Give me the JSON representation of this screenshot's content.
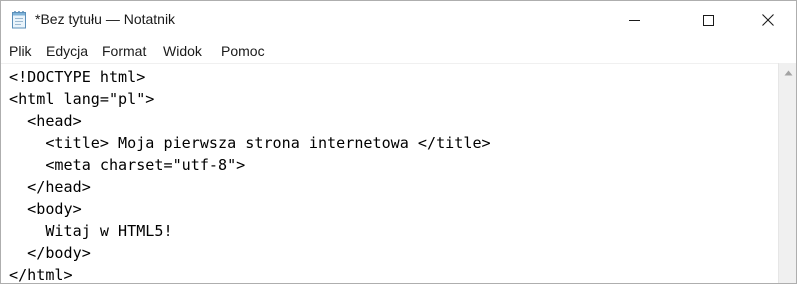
{
  "window": {
    "title": "*Bez tytułu — Notatnik",
    "icon": "notepad-icon"
  },
  "controls": {
    "minimize_icon": "minimize-icon",
    "maximize_icon": "maximize-icon",
    "close_icon": "close-icon"
  },
  "menu": {
    "items": [
      "Plik",
      "Edycja",
      "Format",
      "Widok",
      "Pomoc"
    ]
  },
  "editor": {
    "lines": [
      "<!DOCTYPE html>",
      "<html lang=\"pl\">",
      "  <head>",
      "    <title> Moja pierwsza strona internetowa </title>",
      "    <meta charset=\"utf-8\">",
      "  </head>",
      "  <body>",
      "    Witaj w HTML5!",
      "  </body>",
      "</html>"
    ]
  },
  "scrollbar": {
    "up_icon": "scroll-up-arrow-icon"
  },
  "colors": {
    "background": "#ffffff",
    "text": "#000000",
    "scrollbar_track": "#f0f0f0"
  }
}
